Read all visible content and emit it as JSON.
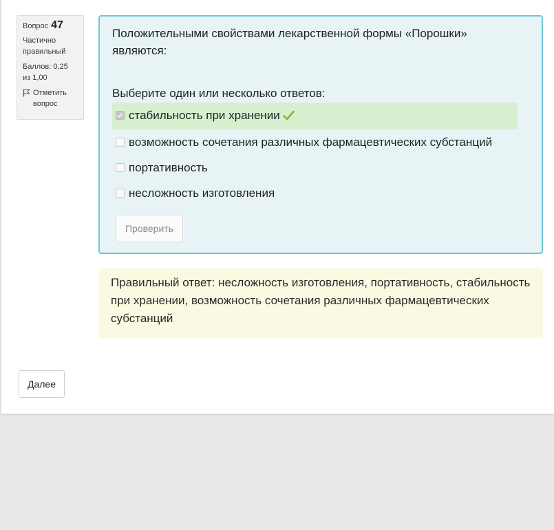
{
  "question_info": {
    "number_label": "Вопрос",
    "number": "47",
    "state": "Частично правильный",
    "grade": "Баллов: 0,25 из 1,00",
    "flag_label": "Отметить вопрос",
    "flag_icon": "flag-icon"
  },
  "question": {
    "text": "Положительными свойствами лекарственной формы «Порошки» являются:",
    "prompt": "Выберите один или несколько ответов:",
    "answers": [
      {
        "label": "стабильность при хранении",
        "checked": true,
        "correct": true
      },
      {
        "label": "возможность сочетания различных фармацевтических субстанций",
        "checked": false
      },
      {
        "label": "портативность",
        "checked": false
      },
      {
        "label": "несложность изготовления",
        "checked": false
      }
    ],
    "check_button": "Проверить"
  },
  "feedback": {
    "right_answer": "Правильный ответ: несложность изготовления, портативность, стабильность при хранении, возможность сочетания различных фармацевтических субстанций"
  },
  "navigation": {
    "next_button": "Далее"
  },
  "colors": {
    "formulation_bg": "#e7f3f5",
    "formulation_border": "#6cc7d6",
    "correct_bg": "#d7efcf",
    "feedback_bg": "#fcf9e2",
    "tick": "#7cbd2b"
  }
}
